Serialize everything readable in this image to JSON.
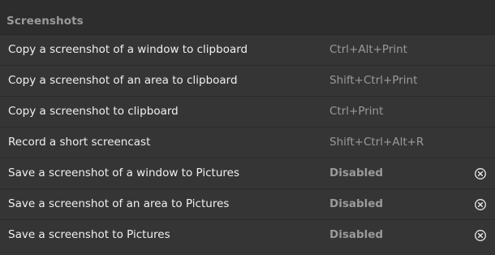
{
  "section": {
    "title": "Screenshots"
  },
  "rows": [
    {
      "label": "Copy a screenshot of a window to clipboard",
      "accelerator": "Ctrl+Alt+Print",
      "disabled": false
    },
    {
      "label": "Copy a screenshot of an area to clipboard",
      "accelerator": "Shift+Ctrl+Print",
      "disabled": false
    },
    {
      "label": "Copy a screenshot to clipboard",
      "accelerator": "Ctrl+Print",
      "disabled": false
    },
    {
      "label": "Record a short screencast",
      "accelerator": "Shift+Ctrl+Alt+R",
      "disabled": false
    },
    {
      "label": "Save a screenshot of a window to Pictures",
      "accelerator": "Disabled",
      "disabled": true,
      "clear_icon": "clear-circle-x-icon"
    },
    {
      "label": "Save a screenshot of an area to Pictures",
      "accelerator": "Disabled",
      "disabled": true,
      "clear_icon": "clear-circle-x-icon"
    },
    {
      "label": "Save a screenshot to Pictures",
      "accelerator": "Disabled",
      "disabled": true,
      "clear_icon": "clear-circle-x-icon"
    }
  ],
  "colors": {
    "background": "#2d2d2d",
    "list_background": "#353535",
    "label_text": "#f0f0f0",
    "secondary_text": "#9a9a9a"
  }
}
